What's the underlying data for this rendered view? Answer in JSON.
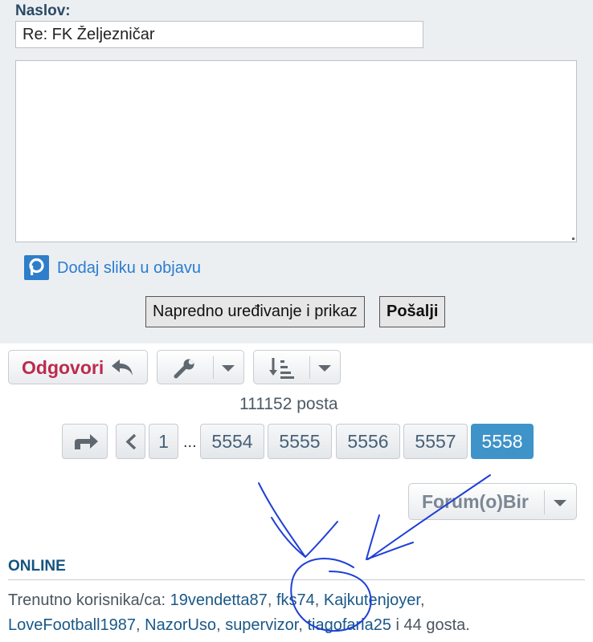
{
  "reply_form": {
    "subject_label": "Naslov:",
    "subject_value": "Re: FK Željezničar",
    "message_value": "",
    "add_image_label": "Dodaj sliku u objavu",
    "advanced_button": "Napredno uređivanje i prikaz",
    "submit_button": "Pošalji"
  },
  "toolbar": {
    "reply_button": "Odgovori",
    "tools_icon": "wrench-icon",
    "sort_icon": "sort-icon"
  },
  "post_count": "111152 posta",
  "pagination": {
    "jump_icon": "jump-arrow-icon",
    "prev_icon": "chevron-left-icon",
    "first": "1",
    "ellipsis": "...",
    "pages": [
      "5554",
      "5555",
      "5556",
      "5557",
      "5558"
    ],
    "current": "5558"
  },
  "forum_jump": {
    "label": "Forum(o)Bir"
  },
  "online": {
    "heading": "ONLINE",
    "prefix": "Trenutno korisnika/ca: ",
    "users": [
      "19vendetta87",
      "fks74",
      "Kajkutenjoyer",
      "LoveFootball1987",
      "NazorUso",
      "supervizor",
      "tiagofaria25"
    ],
    "suffix": " i 44 gosta."
  },
  "colors": {
    "panel_bg": "#eceff2",
    "reply_red": "#bc2a4d",
    "active_page": "#3e93c9",
    "link_blue": "#1a5888",
    "annotation_ink": "#1e3fd8"
  }
}
